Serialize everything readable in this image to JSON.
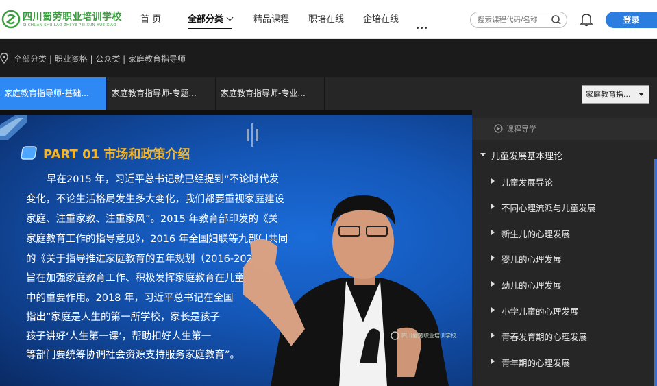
{
  "header": {
    "logo_title": "四川蜀劳职业培训学校",
    "logo_subtitle": "SI CHUAN SHU LAO ZHI YE PEI XUN XUE XIAO",
    "nav": [
      {
        "label": "首 页"
      },
      {
        "label": "全部分类"
      },
      {
        "label": "精品课程"
      },
      {
        "label": "职培在线"
      },
      {
        "label": "企培在线"
      }
    ],
    "search_placeholder": "搜索课程代码/名称",
    "login_label": "登录",
    "brand_color": "#3a9d3f",
    "accent_color": "#2c7de0"
  },
  "breadcrumb": {
    "text": "全部分类 | 职业资格 | 公众类 | 家庭教育指导师"
  },
  "tabs": [
    {
      "label": "家庭教育指导师-基础...",
      "active": true
    },
    {
      "label": "家庭教育指导师-专题..."
    },
    {
      "label": "家庭教育指导师-专业..."
    }
  ],
  "course_select": {
    "value": "家庭教育指..."
  },
  "slide": {
    "part_title": "PART 01 市场和政策介绍",
    "lines": [
      "早在2015 年，习近平总书记就已经提到“不论时代发",
      "变化，不论生活格局发生多大变化，我们都要重视家庭建设",
      "家庭、注重家教、注重家风”。2015 年教育部印发的《关",
      "家庭教育工作的指导意见》，2016 年全国妇联等九部门共同",
      "的《关于指导推进家庭教育的五年规划（2016-2020",
      "旨在加强家庭教育工作、积极发挥家庭教育在儿童",
      "中的重要作用。2018 年，习近平总书记在全国",
      "指出“家庭是人生的第一所学校，家长是孩子",
      "孩子讲好‘人生第一课’，帮助扣好人生第一",
      "等部门要统筹协调社会资源支持服务家庭教育”。"
    ],
    "watermark": "四川蜀劳职业培训学校"
  },
  "sidebar": {
    "header_label": "课程导学",
    "chapter_label": "儿童发展基本理论",
    "lessons": [
      {
        "label": "儿童发展导论"
      },
      {
        "label": "不同心理流派与儿童发展"
      },
      {
        "label": "新生儿的心理发展"
      },
      {
        "label": "婴儿的心理发展"
      },
      {
        "label": "幼儿的心理发展"
      },
      {
        "label": "小学儿童的心理发展"
      },
      {
        "label": "青春发育期的心理发展"
      },
      {
        "label": "青年期的心理发展"
      }
    ]
  }
}
